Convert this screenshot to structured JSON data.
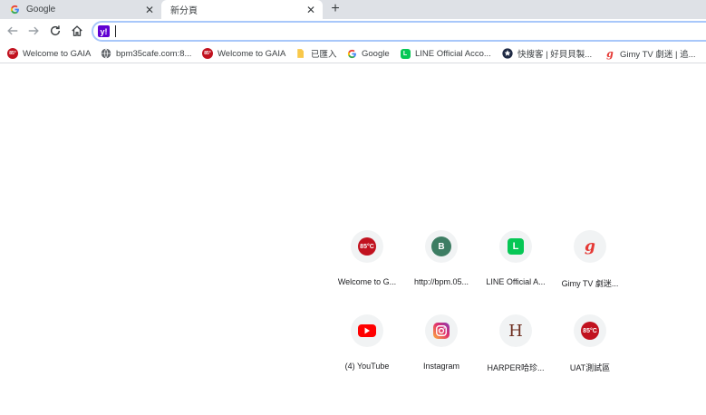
{
  "tabs": [
    {
      "title": "Google",
      "icon": "google-icon",
      "active": false
    },
    {
      "title": "新分頁",
      "icon": "new-tab-icon",
      "active": true
    }
  ],
  "new_tab_label": "+",
  "omnibox": {
    "value": "",
    "placeholder": "",
    "search_engine_icon": "yahoo-icon",
    "search_engine_letter": "y!"
  },
  "bookmarks": [
    {
      "label": "Welcome to GAIA",
      "icon": "85c-icon"
    },
    {
      "label": "bpm35cafe.com:8...",
      "icon": "globe-icon"
    },
    {
      "label": "Welcome to GAIA",
      "icon": "85c-icon"
    },
    {
      "label": "已匯入",
      "icon": "folder-icon"
    },
    {
      "label": "Google",
      "icon": "google-icon"
    },
    {
      "label": "LINE Official Acco...",
      "icon": "line-icon"
    },
    {
      "label": "快搜客 | 好貝貝製...",
      "icon": "star-badge-icon"
    },
    {
      "label": "Gimy TV 劇迷 | 追...",
      "icon": "gimy-icon"
    }
  ],
  "shortcuts": [
    {
      "label": "Welcome to G...",
      "icon": "85c-icon",
      "glyph": "85°C"
    },
    {
      "label": "http://bpm.05...",
      "icon": "letter-b-icon",
      "glyph": "B"
    },
    {
      "label": "LINE Official A...",
      "icon": "line-icon",
      "glyph": "L"
    },
    {
      "label": "Gimy TV 劇迷...",
      "icon": "gimy-icon",
      "glyph": "g"
    },
    {
      "label": "(4) YouTube",
      "icon": "youtube-icon",
      "glyph": ""
    },
    {
      "label": "Instagram",
      "icon": "instagram-icon",
      "glyph": ""
    },
    {
      "label": "HARPER哈珍...",
      "icon": "letter-h-icon",
      "glyph": "H"
    },
    {
      "label": "UAT測試區",
      "icon": "85c-icon",
      "glyph": "85°C"
    }
  ],
  "colors": {
    "tabstrip": "#dee1e6",
    "omnibox_focus": "#a8c7fa",
    "yahoo": "#6001d2",
    "line": "#06c755",
    "youtube": "#ff0000",
    "brand_85c": "#c1121f"
  }
}
